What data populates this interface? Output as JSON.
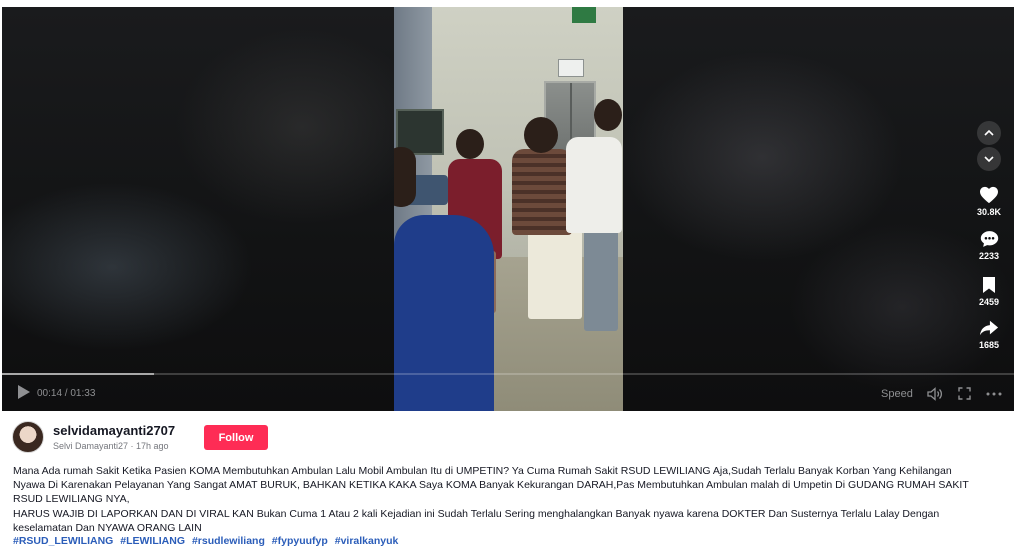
{
  "player": {
    "time": "00:14 / 01:33",
    "progress": 0.15,
    "speed_label": "Speed"
  },
  "stats": {
    "likes": "30.8K",
    "comments": "2233",
    "saves": "2459",
    "shares": "1685"
  },
  "author": {
    "username": "selvidamayanti2707",
    "subline": "Selvi Damayanti27 · 17h ago",
    "follow_label": "Follow"
  },
  "description": {
    "line1": "Mana Ada rumah Sakit Ketika Pasien KOMA Membutuhkan Ambulan Lalu Mobil Ambulan Itu di UMPETIN? Ya Cuma Rumah Sakit RSUD LEWILIANG Aja,Sudah Terlalu Banyak Korban Yang Kehilangan",
    "line2": "Nyawa Di Karenakan Pelayanan Yang Sangat AMAT BURUK, BAHKAN KETIKA KAKA Saya KOMA Banyak Kekurangan DARAH,Pas Membutuhkan Ambulan malah di Umpetin Di GUDANG RUMAH SAKIT",
    "line3": "RSUD LEWILIANG NYA,",
    "line4": "HARUS WAJIB DI LAPORKAN DAN DI VIRAL KAN Bukan Cuma 1 Atau 2 kali Kejadian ini Sudah Terlalu Sering menghalangkan Banyak nyawa karena DOKTER Dan Susternya Terlalu Lalay Dengan",
    "line5": "keselamatan Dan NYAWA ORANG LAIN"
  },
  "hashtags": [
    "#RSUD_LEWILIANG",
    "#LEWILIANG",
    "#rsudlewiliang",
    "#fypyuufyp",
    "#viralkanyuk"
  ],
  "icons": {
    "play": "play-icon",
    "volume": "volume-icon",
    "fullscreen": "fullscreen-icon",
    "more": "more-icon",
    "up": "chevron-up-icon",
    "down": "chevron-down-icon",
    "like": "heart-icon",
    "comment": "comment-icon",
    "save": "bookmark-icon",
    "share": "share-icon"
  },
  "colors": {
    "follow": "#fe2c55",
    "hashtag": "#2b5db9"
  }
}
